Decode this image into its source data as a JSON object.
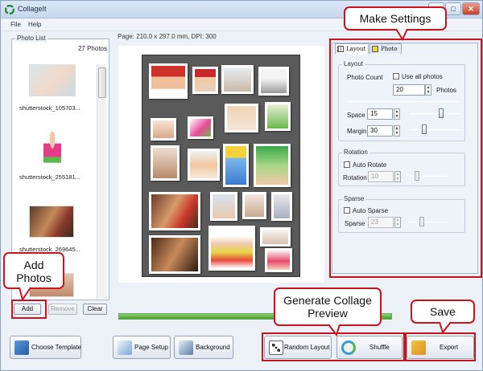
{
  "window": {
    "title": "CollageIt",
    "min": "–",
    "max": "□",
    "close": "✕"
  },
  "menu": [
    "File",
    "Help"
  ],
  "photo_list": {
    "label": "Photo List",
    "count": "27 Photos",
    "items": [
      {
        "caption": "shutterstock_105703..."
      },
      {
        "caption": "shutterstock_255181..."
      },
      {
        "caption": "shutterstock_269645..."
      }
    ],
    "buttons": {
      "add": "Add",
      "remove": "Remove",
      "clear": "Clear"
    }
  },
  "page_info": "Page: 210.0 x 297.0 mm, DPI: 300",
  "progress": {
    "value": 1.0
  },
  "settings": {
    "tabs": {
      "layout": "Layout",
      "photo": "Photo"
    },
    "layout_group": {
      "title": "Layout",
      "photo_count_label": "Photo Count",
      "use_all_label": "Use all photos",
      "count_value": "20",
      "count_unit": "Photos",
      "space_label": "Space",
      "space_value": "15",
      "margin_label": "Margin",
      "margin_value": "30"
    },
    "rotation_group": {
      "title": "Rotation",
      "auto_label": "Auto Rotate",
      "rotation_label": "Rotation",
      "rotation_value": "10"
    },
    "sparse_group": {
      "title": "Sparse",
      "auto_label": "Auto Sparse",
      "sparse_label": "Sparse",
      "sparse_value": "23"
    }
  },
  "bottom_buttons": {
    "choose_template": "Choose Template",
    "page_setup": "Page Setup",
    "background": "Background",
    "random_layout": "Random Layout",
    "shuffle": "Shuffle",
    "export": "Export"
  },
  "callouts": {
    "make_settings": "Make Settings",
    "add_photos": "Add Photos",
    "generate": "Generate Collage Preview",
    "save": "Save"
  },
  "colors": {
    "callout_border": "#c8141c",
    "accent": "#4a86c8"
  }
}
